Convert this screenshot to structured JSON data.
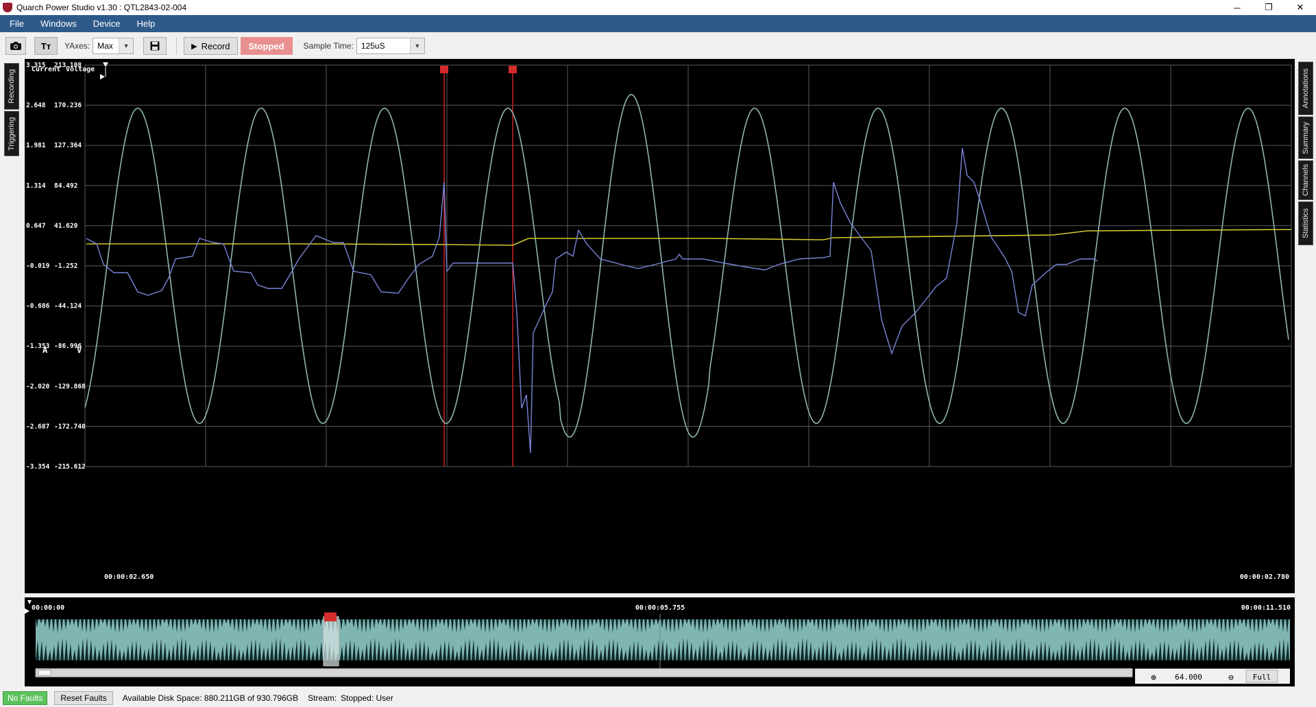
{
  "window": {
    "title": "Quarch Power Studio v1.30 : QTL2843-02-004",
    "minimize": "─",
    "maximize": "❐",
    "close": "✕"
  },
  "menu": {
    "items": [
      "File",
      "Windows",
      "Device",
      "Help"
    ]
  },
  "toolbar": {
    "camera_icon": "camera-icon",
    "text_icon": "Tт",
    "yaxes_label": "YAxes:",
    "yaxes_value": "Max",
    "save_icon": "save-icon",
    "record_label": "Record",
    "status": "Stopped",
    "sample_time_label": "Sample Time:",
    "sample_time_value": "125uS"
  },
  "left_tabs": [
    "Recording",
    "Triggering"
  ],
  "right_tabs": [
    "Annotations",
    "Summary",
    "Channels",
    "Statistics"
  ],
  "plot": {
    "header_current": "Current",
    "header_voltage": "Voltage",
    "unit_current": "A",
    "unit_voltage": "V",
    "current_ticks": [
      "3.315",
      "2.648",
      "1.981",
      "1.314",
      "0.647",
      "-0.019",
      "-0.686",
      "-1.353",
      "-2.020",
      "-2.687",
      "-3.354"
    ],
    "voltage_ticks": [
      "213.108",
      "170.236",
      "127.364",
      "84.492",
      "41.620",
      "-1.252",
      "-44.124",
      "-86.996",
      "-129.868",
      "-172.740",
      "-215.612"
    ],
    "time_start": "00:00:02.650",
    "time_end": "00:00:02.780",
    "colors": {
      "voltage": "#8fb5b2",
      "current": "#7a86d8",
      "power": "#d4c830",
      "marker": "#cc2222",
      "grid": "#5a5a5a"
    }
  },
  "overview": {
    "time_start": "00:00:00",
    "time_mid": "00:00:05.755",
    "time_end": "00:00:11.510",
    "zoom_value": "64.000",
    "full_label": "Full",
    "fill_color": "#7fb5b2"
  },
  "status": {
    "faults": "No Faults",
    "reset": "Reset Faults",
    "disk": "Available Disk Space: 880.211GB of 930.796GB",
    "stream_label": "Stream:",
    "stream_value": "Stopped: User"
  }
}
